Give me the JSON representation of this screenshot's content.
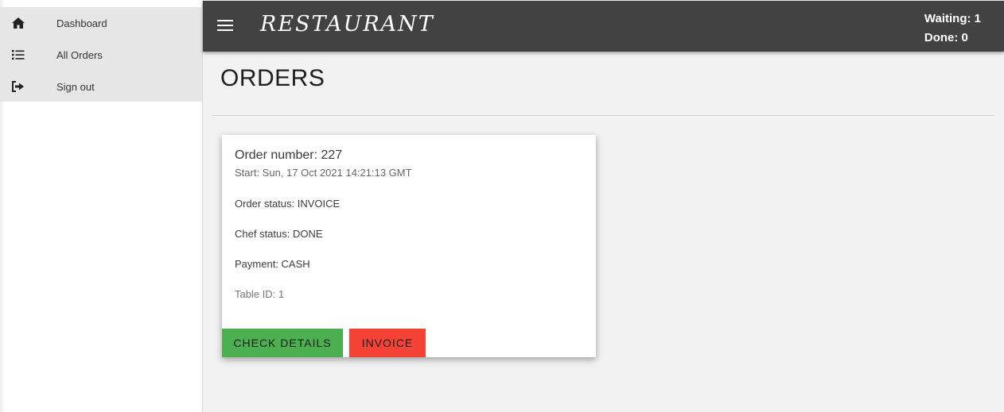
{
  "sidebar": {
    "items": [
      {
        "label": "Dashboard",
        "icon": "home-icon"
      },
      {
        "label": "All Orders",
        "icon": "list-icon"
      },
      {
        "label": "Sign out",
        "icon": "sign-out-icon"
      }
    ]
  },
  "header": {
    "brand": "RESTAURANT",
    "waiting": "Waiting: 1",
    "done": "Done: 0"
  },
  "page": {
    "title": "ORDERS"
  },
  "order": {
    "number": "Order number: 227",
    "start": "Start: Sun, 17 Oct 2021 14:21:13 GMT",
    "order_status": "Order status: INVOICE",
    "chef_status": "Chef status: DONE",
    "payment": "Payment: CASH",
    "table_id": "Table ID: 1",
    "buttons": {
      "details": "CHECK DETAILS",
      "invoice": "INVOICE"
    }
  },
  "colors": {
    "topbar": "#424242",
    "details_button": "#4caf50",
    "invoice_button": "#f44336"
  }
}
